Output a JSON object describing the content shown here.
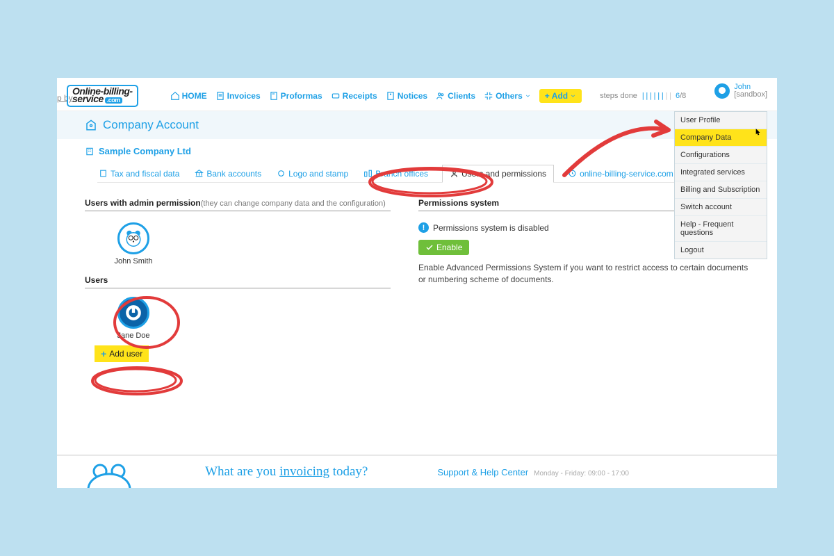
{
  "edge_text": "p by",
  "logo": {
    "line1": "Online-billing-",
    "line2": "service",
    "tld": ".com"
  },
  "nav": {
    "home": "HOME",
    "invoices": "Invoices",
    "proformas": "Proformas",
    "receipts": "Receipts",
    "notices": "Notices",
    "clients": "Clients",
    "others": "Others",
    "add": "Add"
  },
  "steps": {
    "label": "steps done",
    "current": "6",
    "total": "8"
  },
  "user": {
    "name": "John",
    "env": "[sandbox]"
  },
  "usermenu": [
    "User Profile",
    "Company Data",
    "Configurations",
    "Integrated services",
    "Billing and Subscription",
    "Switch account",
    "Help - Frequent questions",
    "Logout"
  ],
  "usermenu_hover_index": 1,
  "breadcrumb": "Company Account",
  "company_name": "Sample Company Ltd",
  "tabs": {
    "tax": "Tax and fiscal data",
    "bank": "Bank accounts",
    "logo": "Logo and stamp",
    "branch": "Branch offices",
    "users": "Users and permissions",
    "subscription": "online-billing-service.com subscription"
  },
  "left": {
    "heading": "Users with admin permission",
    "heading_sub": "(they can change company data and the configuration)",
    "admin_name": "John Smith",
    "subheading": "Users",
    "user_name": "Jane Doe",
    "add_user": "Add user"
  },
  "right": {
    "heading": "Permissions system",
    "disabled_line": "Permissions system is disabled",
    "enable": "Enable",
    "help": "Enable Advanced Permissions System if you want to restrict access to certain documents or numbering scheme of documents."
  },
  "footer": {
    "tag_before": "What are you ",
    "tag_underlined": "invoicing",
    "tag_after": " today?",
    "support": "Support & Help Center",
    "hours": "Monday - Friday: 09:00 - 17:00"
  }
}
